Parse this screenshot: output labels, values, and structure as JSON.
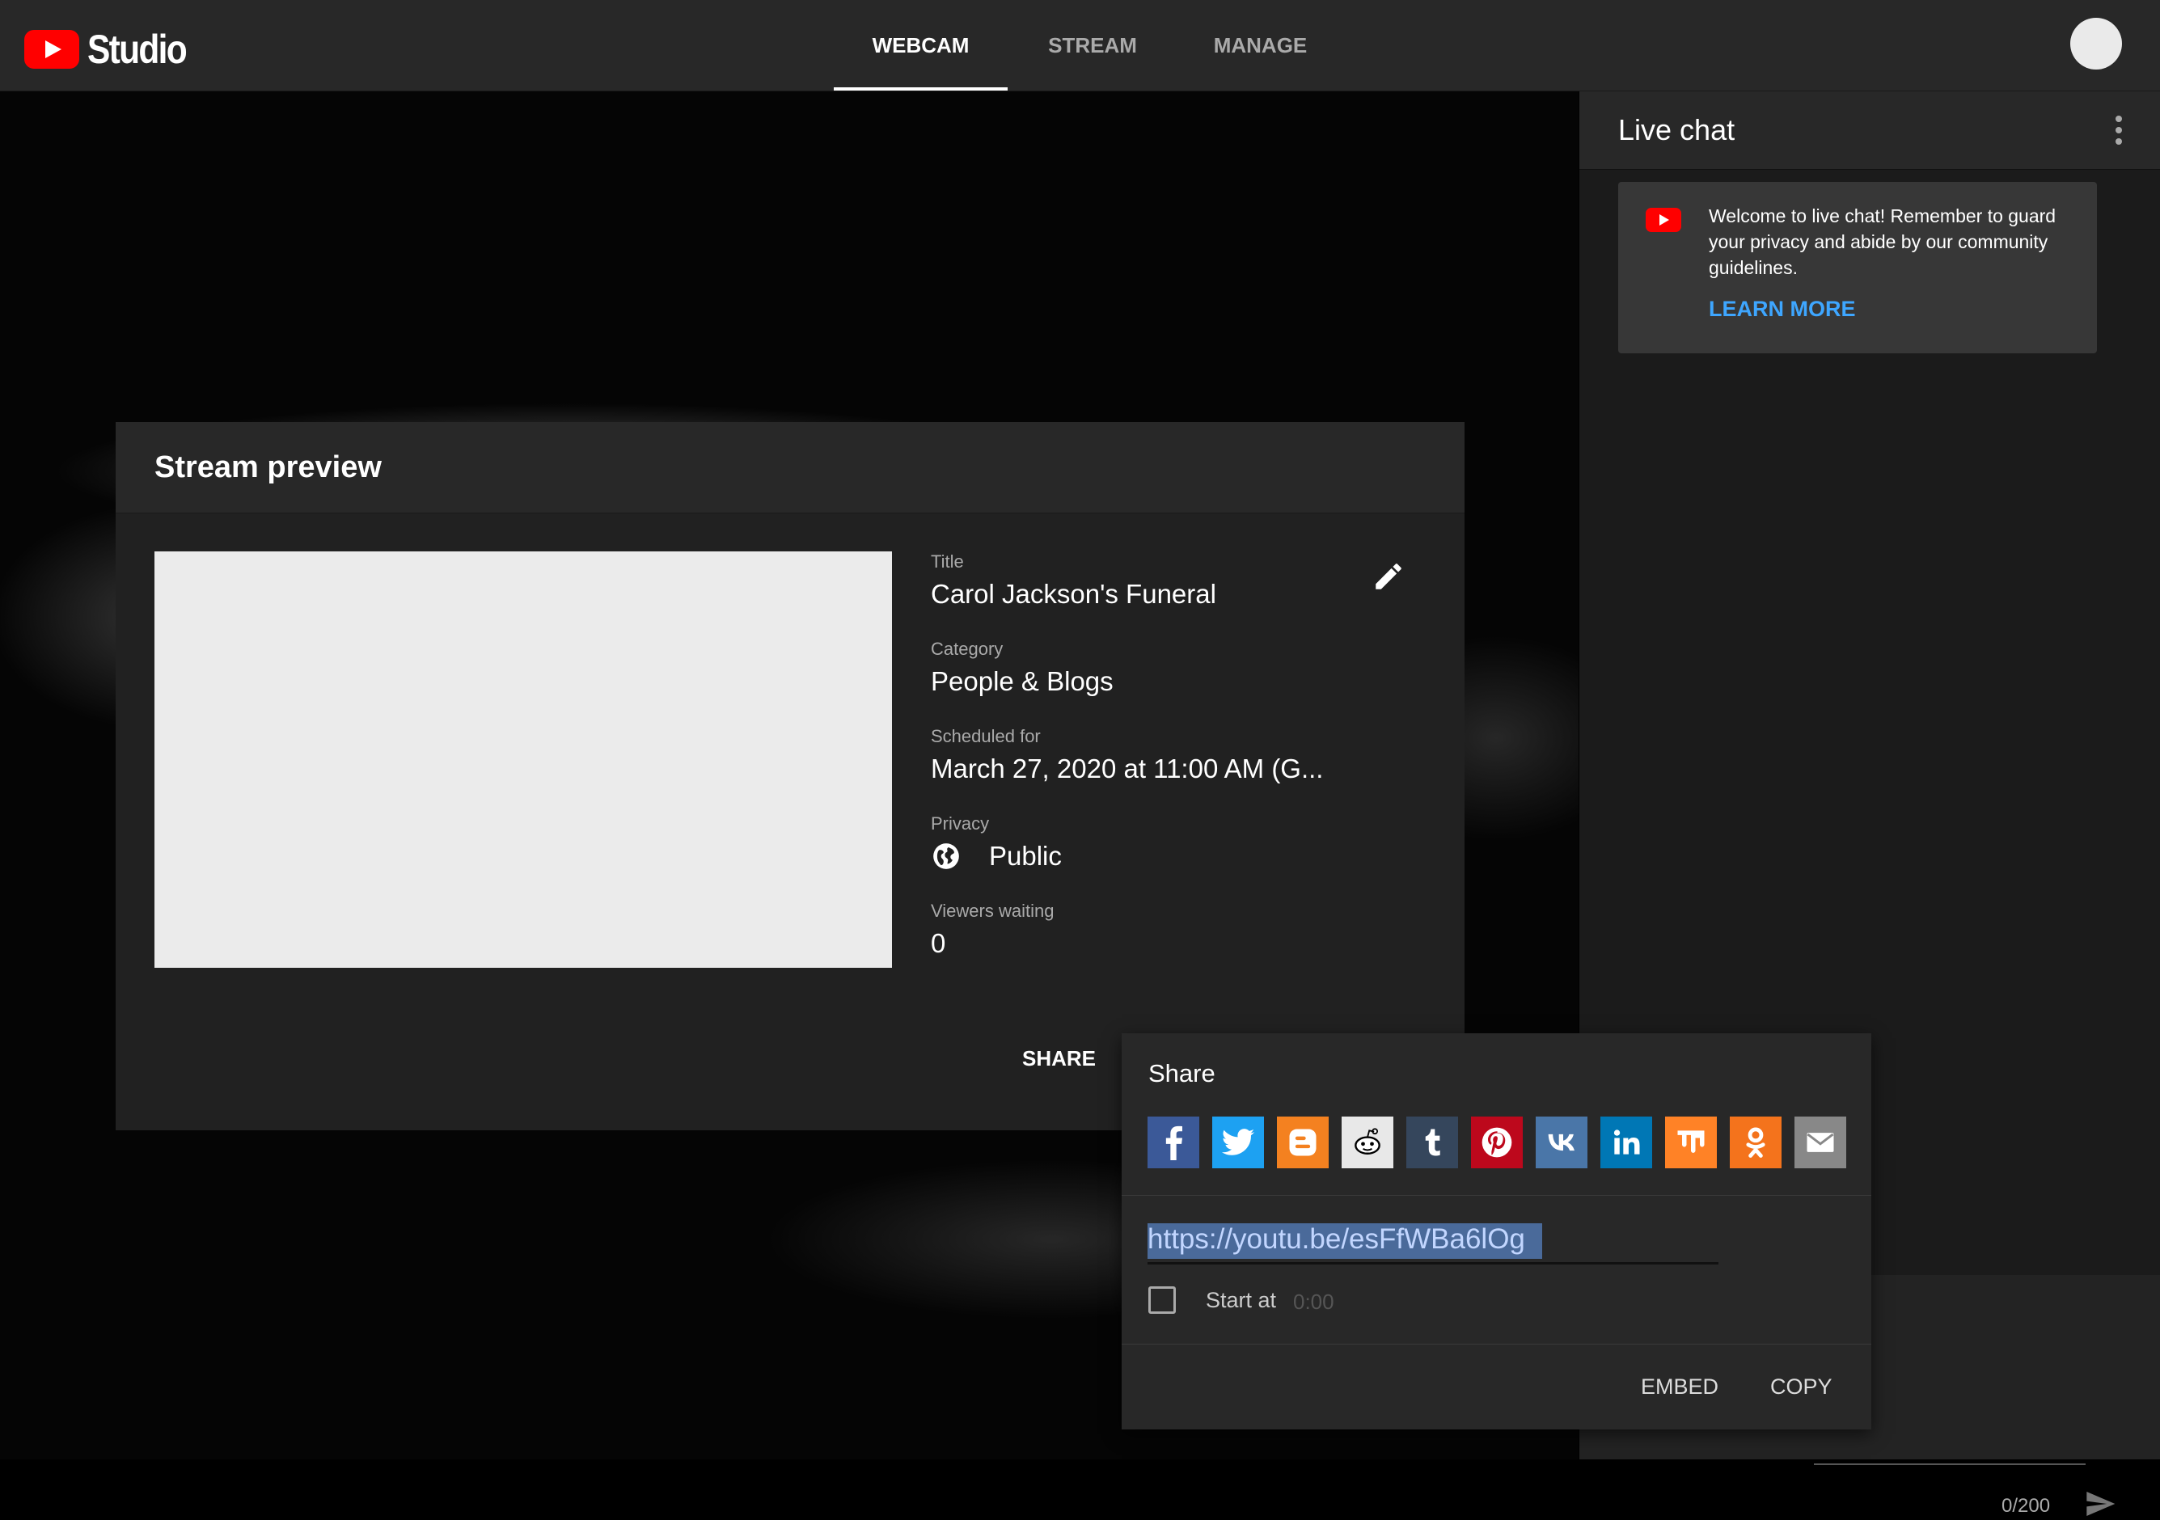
{
  "app": {
    "logo_text": "Studio"
  },
  "nav": {
    "tabs": [
      "WEBCAM",
      "STREAM",
      "MANAGE"
    ],
    "active": "WEBCAM"
  },
  "preview": {
    "heading": "Stream preview",
    "fields": {
      "title_label": "Title",
      "title_value": "Carol Jackson's Funeral",
      "category_label": "Category",
      "category_value": "People & Blogs",
      "scheduled_label": "Scheduled for",
      "scheduled_value": "March 27, 2020 at 11:00 AM (G...",
      "privacy_label": "Privacy",
      "privacy_value": "Public",
      "viewers_label": "Viewers waiting",
      "viewers_value": "0"
    },
    "share_label": "SHARE"
  },
  "chat": {
    "title": "Live chat",
    "welcome_text": "Welcome to live chat! Remember to guard your privacy and abide by our community guidelines.",
    "learn_more": "LEARN MORE",
    "char_count": "0/200"
  },
  "share": {
    "title": "Share",
    "networks": [
      "facebook",
      "twitter",
      "blogger",
      "reddit",
      "tumblr",
      "pinterest",
      "vk",
      "linkedin",
      "mix",
      "odnoklassniki",
      "email"
    ],
    "url": "https://youtu.be/esFfWBa6lOg",
    "start_at_label": "Start at",
    "start_at_value": "0:00",
    "embed_label": "EMBED",
    "copy_label": "COPY"
  },
  "colors": {
    "brand_red": "#ff0000",
    "link_blue": "#3ea6ff",
    "facebook": "#3b5998",
    "twitter": "#1da1f2",
    "blogger": "#f48120",
    "reddit": "#ffffff",
    "tumblr": "#35465c",
    "pinterest": "#bd081c",
    "vk": "#4a76a8",
    "linkedin": "#0077b5",
    "mix": "#ff8226",
    "odnoklassniki": "#f4731c",
    "email": "#888888"
  }
}
